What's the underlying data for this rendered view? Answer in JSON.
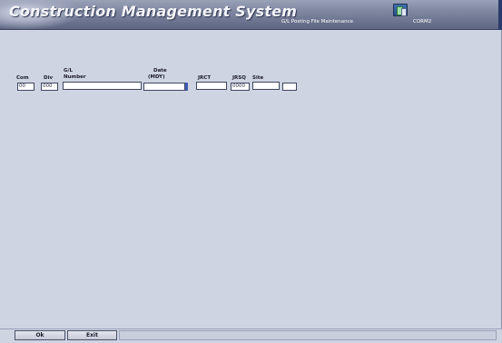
{
  "header": {
    "app_title": "Construction Management System",
    "screen_title": "G/L Posting File Maintenance",
    "screen_code": "CORM2"
  },
  "form": {
    "com_label": "Com",
    "div_label": "Div",
    "gl_label_1": "G/L",
    "gl_label_2": "Number",
    "date_label_1": "Date",
    "date_label_2": "(MDY)",
    "jrct_label": "JRCT",
    "jrsq_label": "JRSQ",
    "site_label": "Site",
    "com_value": "00",
    "div_value": "000",
    "gl_value": "",
    "date_value": "",
    "jrct_value": "",
    "jrsq_value": "0000",
    "site_value": "",
    "extra_value": ""
  },
  "footer": {
    "ok_label": "Ok",
    "exit_label": "Exit"
  },
  "colors": {
    "background": "#cfd4e2",
    "header": "#7e86a0",
    "accent": "#3d5cb4"
  },
  "icons": {
    "toolbar": "window-icon"
  }
}
